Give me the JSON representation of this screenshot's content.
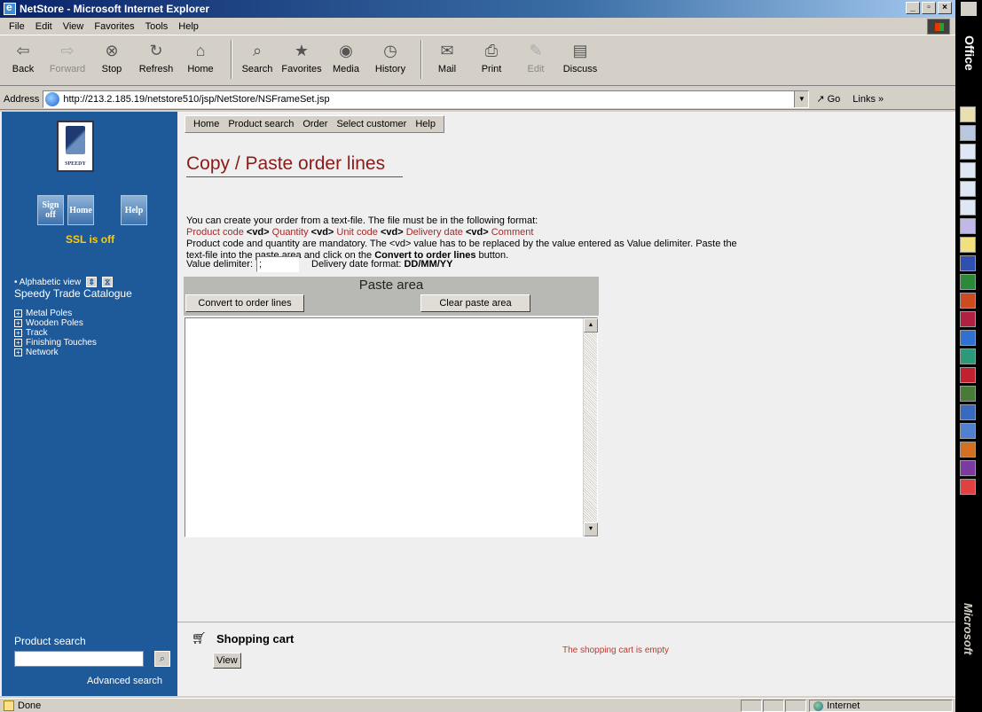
{
  "window": {
    "title": "NetStore - Microsoft Internet Explorer",
    "btn_min": "_",
    "btn_max": "▫",
    "btn_close": "×"
  },
  "menu": [
    "File",
    "Edit",
    "View",
    "Favorites",
    "Tools",
    "Help"
  ],
  "toolbar": [
    {
      "label": "Back",
      "icon": "back-arrow-icon",
      "glyph": "⇦",
      "enabled": true
    },
    {
      "label": "Forward",
      "icon": "forward-arrow-icon",
      "glyph": "⇨",
      "enabled": false
    },
    {
      "label": "Stop",
      "icon": "stop-icon",
      "glyph": "⊗",
      "enabled": true
    },
    {
      "label": "Refresh",
      "icon": "refresh-icon",
      "glyph": "↻",
      "enabled": true
    },
    {
      "label": "Home",
      "icon": "home-icon",
      "glyph": "⌂",
      "enabled": true
    },
    {
      "label": "Search",
      "icon": "search-icon",
      "glyph": "⌕",
      "enabled": true
    },
    {
      "label": "Favorites",
      "icon": "favorites-icon",
      "glyph": "★",
      "enabled": true
    },
    {
      "label": "Media",
      "icon": "media-icon",
      "glyph": "◉",
      "enabled": true
    },
    {
      "label": "History",
      "icon": "history-icon",
      "glyph": "◷",
      "enabled": true
    },
    {
      "label": "Mail",
      "icon": "mail-icon",
      "glyph": "✉",
      "enabled": true
    },
    {
      "label": "Print",
      "icon": "print-icon",
      "glyph": "⎙",
      "enabled": true
    },
    {
      "label": "Edit",
      "icon": "edit-icon",
      "glyph": "✎",
      "enabled": false
    },
    {
      "label": "Discuss",
      "icon": "discuss-icon",
      "glyph": "▤",
      "enabled": true
    }
  ],
  "address": {
    "label": "Address",
    "url": "http://213.2.185.19/netstore510/jsp/NetStore/NSFrameSet.jsp",
    "go": "Go",
    "links": "Links",
    "links_chevron": "»"
  },
  "sidebar": {
    "logo_text": "SPEEDY",
    "buttons": {
      "signoff": "Sign off",
      "home": "Home",
      "help": "Help"
    },
    "ssl": "SSL is off",
    "alpha_view": "• Alphabetic view",
    "catalog_title": "Speedy Trade Catalogue",
    "tree": [
      "Metal Poles",
      "Wooden Poles",
      "Track",
      "Finishing Touches",
      "Network"
    ],
    "product_search_label": "Product search",
    "advanced_search": "Advanced search"
  },
  "nav": [
    "Home",
    "Product search",
    "Order",
    "Select customer",
    "Help"
  ],
  "content": {
    "title": "Copy / Paste order lines",
    "intro": "You can create your order from a text-file. The file must be in the following format:",
    "format": {
      "product_code": "Product code",
      "quantity": "Quantity",
      "unit_code": "Unit code",
      "delivery_date": "Delivery date",
      "comment": "Comment",
      "vd": "<vd>"
    },
    "mandatory_pre": "Product code and quantity are mandatory. The <vd> value has to be replaced by the value entered as Value delimiter.  Paste the",
    "mandatory_post_a": "text-file into the paste area and click on the",
    "mandatory_bold": "Convert to order lines",
    "mandatory_post_b": "button.",
    "delimiter_label": "Value delimiter:",
    "delimiter_value": ";",
    "date_format_label": "Delivery date format:",
    "date_format_value": "DD/MM/YY",
    "paste_area_title": "Paste area",
    "convert_button": "Convert to order lines",
    "clear_button": "Clear paste area",
    "paste_text": ""
  },
  "cart": {
    "title": "Shopping cart",
    "view_button": "View",
    "empty_message": "The shopping cart is empty"
  },
  "status": {
    "text": "Done",
    "zone": "Internet"
  },
  "office_bar": {
    "title": "Office",
    "brand": "Microsoft"
  },
  "colors": {
    "sidebar_blue": "#1e5999",
    "title_red": "#8b1a1a",
    "format_red": "#a52a2a",
    "ssl_yellow": "#ffcc00"
  }
}
